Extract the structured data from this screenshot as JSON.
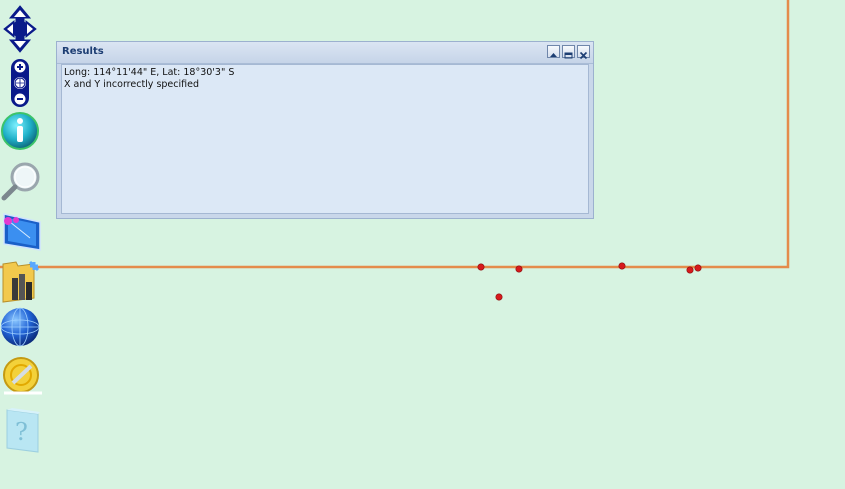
{
  "results_panel": {
    "title": "Results",
    "lines": [
      "Long: 114°11'44\" E, Lat: 18°30'3\" S",
      "X and Y incorrectly specified"
    ],
    "buttons": [
      "collapse-icon",
      "dock-icon",
      "close-icon"
    ]
  },
  "toolbar": {
    "tools": [
      {
        "name": "pan-tool",
        "icon": "four-way-arrow-icon"
      },
      {
        "name": "zoom-tool",
        "icon": "zoom-in-out-globe-icon"
      },
      {
        "name": "identify-tool",
        "icon": "info-icon"
      },
      {
        "name": "search-tool",
        "icon": "magnifier-icon"
      },
      {
        "name": "measure-tool",
        "icon": "measure-screen-icon"
      },
      {
        "name": "layers-tool",
        "icon": "folder-layers-icon"
      },
      {
        "name": "globe-tool",
        "icon": "globe-icon"
      },
      {
        "name": "clear-tool",
        "icon": "eraser-icon"
      },
      {
        "name": "help-tool",
        "icon": "help-icon"
      }
    ]
  },
  "colors": {
    "map_background": "#d7f3e1",
    "boundary_line": "#e48b4b",
    "point_marker": "#d7191c"
  },
  "map_points_count_visible": 6
}
